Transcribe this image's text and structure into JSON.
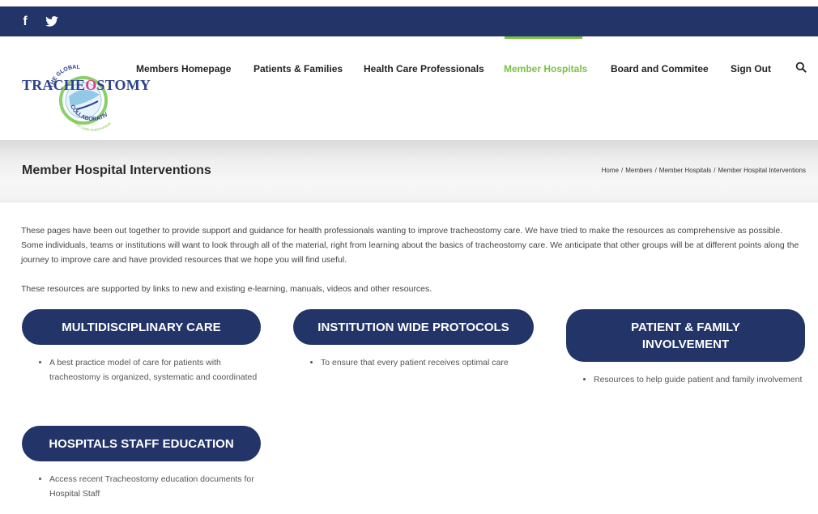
{
  "social": {
    "facebook": "f"
  },
  "logo": {
    "arc_top": "THE GLOBAL",
    "word_part1": "TRACHE",
    "word_part2": "O",
    "word_part3": "STOMY",
    "arc_bottom": "COLLABORATIVE",
    "tagline": "SAFER CARE EVERYWHERE"
  },
  "nav": {
    "items": [
      {
        "label": "Members Homepage"
      },
      {
        "label": "Patients & Families"
      },
      {
        "label": "Health Care Professionals"
      },
      {
        "label": "Member Hospitals",
        "active": true
      },
      {
        "label": "Board and Commitee"
      },
      {
        "label": "Sign Out"
      }
    ]
  },
  "page": {
    "title": "Member Hospital Interventions",
    "breadcrumb": [
      "Home",
      "Members",
      "Member Hospitals",
      "Member Hospital Interventions"
    ]
  },
  "intro": {
    "p1": "These pages have been out together to provide support and guidance for health professionals wanting to improve tracheostomy care. We have tried to make the resources as comprehensive as possible. Some individuals, teams or institutions will want to look through all of the material, right from learning about the basics of tracheostomy care. We anticipate that other groups will be at different points along the journey to improve care and have provided resources that we hope you will find useful.",
    "p2": "These resources are supported by links to new and existing e-learning, manuals, videos and other resources."
  },
  "cards": [
    {
      "title": "MULTIDISCIPLINARY CARE",
      "bullet": "A best practice model of care for patients with tracheostomy is organized, systematic and coordinated"
    },
    {
      "title": "INSTITUTION WIDE PROTOCOLS",
      "bullet": "To ensure that every patient receives optimal care"
    },
    {
      "title": "PATIENT & FAMILY INVOLVEMENT",
      "bullet": "Resources to help guide patient and family involvement"
    },
    {
      "title": "HOSPITALS STAFF EDUCATION",
      "bullet": "Access recent Tracheostomy education documents for Hospital Staff"
    }
  ],
  "colors": {
    "navy": "#223468",
    "active_green": "#7dc142",
    "logo_blue": "#2b3f8c",
    "logo_pink": "#e23a8a"
  }
}
